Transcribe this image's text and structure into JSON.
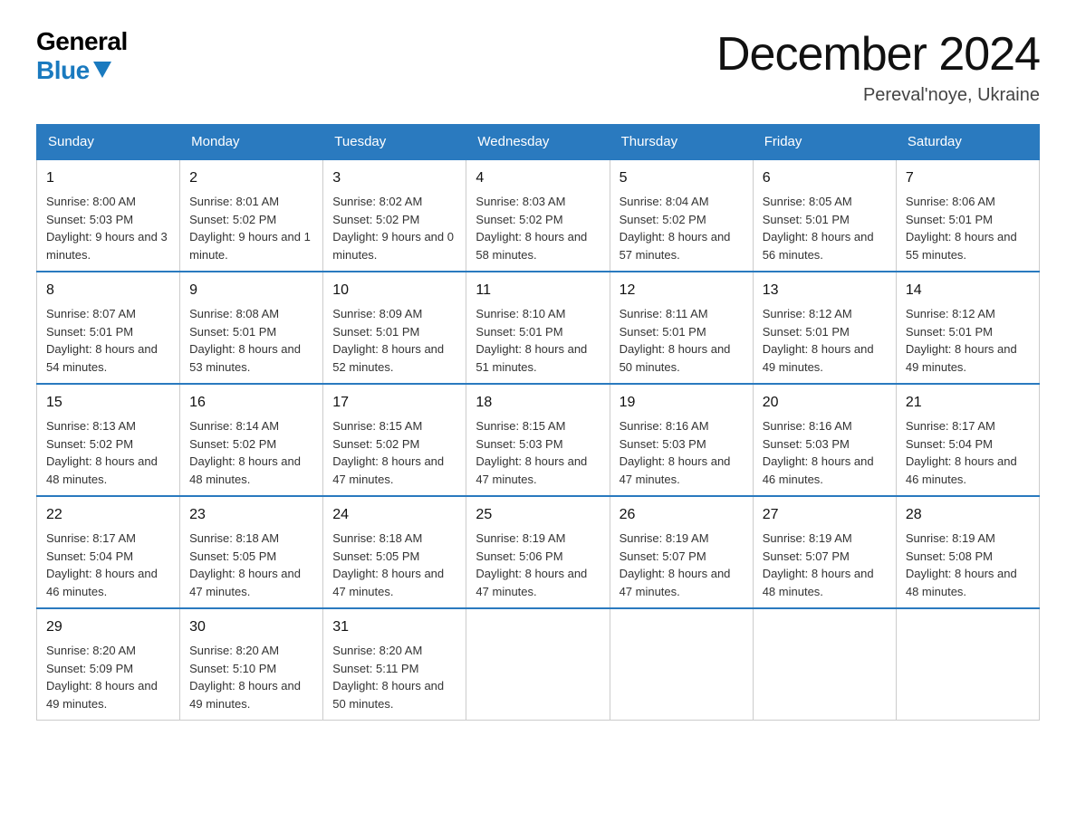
{
  "logo": {
    "general": "General",
    "blue": "Blue"
  },
  "title": "December 2024",
  "subtitle": "Pereval'noye, Ukraine",
  "days_of_week": [
    "Sunday",
    "Monday",
    "Tuesday",
    "Wednesday",
    "Thursday",
    "Friday",
    "Saturday"
  ],
  "weeks": [
    [
      {
        "day": "1",
        "sunrise": "8:00 AM",
        "sunset": "5:03 PM",
        "daylight": "9 hours and 3 minutes."
      },
      {
        "day": "2",
        "sunrise": "8:01 AM",
        "sunset": "5:02 PM",
        "daylight": "9 hours and 1 minute."
      },
      {
        "day": "3",
        "sunrise": "8:02 AM",
        "sunset": "5:02 PM",
        "daylight": "9 hours and 0 minutes."
      },
      {
        "day": "4",
        "sunrise": "8:03 AM",
        "sunset": "5:02 PM",
        "daylight": "8 hours and 58 minutes."
      },
      {
        "day": "5",
        "sunrise": "8:04 AM",
        "sunset": "5:02 PM",
        "daylight": "8 hours and 57 minutes."
      },
      {
        "day": "6",
        "sunrise": "8:05 AM",
        "sunset": "5:01 PM",
        "daylight": "8 hours and 56 minutes."
      },
      {
        "day": "7",
        "sunrise": "8:06 AM",
        "sunset": "5:01 PM",
        "daylight": "8 hours and 55 minutes."
      }
    ],
    [
      {
        "day": "8",
        "sunrise": "8:07 AM",
        "sunset": "5:01 PM",
        "daylight": "8 hours and 54 minutes."
      },
      {
        "day": "9",
        "sunrise": "8:08 AM",
        "sunset": "5:01 PM",
        "daylight": "8 hours and 53 minutes."
      },
      {
        "day": "10",
        "sunrise": "8:09 AM",
        "sunset": "5:01 PM",
        "daylight": "8 hours and 52 minutes."
      },
      {
        "day": "11",
        "sunrise": "8:10 AM",
        "sunset": "5:01 PM",
        "daylight": "8 hours and 51 minutes."
      },
      {
        "day": "12",
        "sunrise": "8:11 AM",
        "sunset": "5:01 PM",
        "daylight": "8 hours and 50 minutes."
      },
      {
        "day": "13",
        "sunrise": "8:12 AM",
        "sunset": "5:01 PM",
        "daylight": "8 hours and 49 minutes."
      },
      {
        "day": "14",
        "sunrise": "8:12 AM",
        "sunset": "5:01 PM",
        "daylight": "8 hours and 49 minutes."
      }
    ],
    [
      {
        "day": "15",
        "sunrise": "8:13 AM",
        "sunset": "5:02 PM",
        "daylight": "8 hours and 48 minutes."
      },
      {
        "day": "16",
        "sunrise": "8:14 AM",
        "sunset": "5:02 PM",
        "daylight": "8 hours and 48 minutes."
      },
      {
        "day": "17",
        "sunrise": "8:15 AM",
        "sunset": "5:02 PM",
        "daylight": "8 hours and 47 minutes."
      },
      {
        "day": "18",
        "sunrise": "8:15 AM",
        "sunset": "5:03 PM",
        "daylight": "8 hours and 47 minutes."
      },
      {
        "day": "19",
        "sunrise": "8:16 AM",
        "sunset": "5:03 PM",
        "daylight": "8 hours and 47 minutes."
      },
      {
        "day": "20",
        "sunrise": "8:16 AM",
        "sunset": "5:03 PM",
        "daylight": "8 hours and 46 minutes."
      },
      {
        "day": "21",
        "sunrise": "8:17 AM",
        "sunset": "5:04 PM",
        "daylight": "8 hours and 46 minutes."
      }
    ],
    [
      {
        "day": "22",
        "sunrise": "8:17 AM",
        "sunset": "5:04 PM",
        "daylight": "8 hours and 46 minutes."
      },
      {
        "day": "23",
        "sunrise": "8:18 AM",
        "sunset": "5:05 PM",
        "daylight": "8 hours and 47 minutes."
      },
      {
        "day": "24",
        "sunrise": "8:18 AM",
        "sunset": "5:05 PM",
        "daylight": "8 hours and 47 minutes."
      },
      {
        "day": "25",
        "sunrise": "8:19 AM",
        "sunset": "5:06 PM",
        "daylight": "8 hours and 47 minutes."
      },
      {
        "day": "26",
        "sunrise": "8:19 AM",
        "sunset": "5:07 PM",
        "daylight": "8 hours and 47 minutes."
      },
      {
        "day": "27",
        "sunrise": "8:19 AM",
        "sunset": "5:07 PM",
        "daylight": "8 hours and 48 minutes."
      },
      {
        "day": "28",
        "sunrise": "8:19 AM",
        "sunset": "5:08 PM",
        "daylight": "8 hours and 48 minutes."
      }
    ],
    [
      {
        "day": "29",
        "sunrise": "8:20 AM",
        "sunset": "5:09 PM",
        "daylight": "8 hours and 49 minutes."
      },
      {
        "day": "30",
        "sunrise": "8:20 AM",
        "sunset": "5:10 PM",
        "daylight": "8 hours and 49 minutes."
      },
      {
        "day": "31",
        "sunrise": "8:20 AM",
        "sunset": "5:11 PM",
        "daylight": "8 hours and 50 minutes."
      },
      null,
      null,
      null,
      null
    ]
  ],
  "labels": {
    "sunrise": "Sunrise:",
    "sunset": "Sunset:",
    "daylight": "Daylight:"
  }
}
